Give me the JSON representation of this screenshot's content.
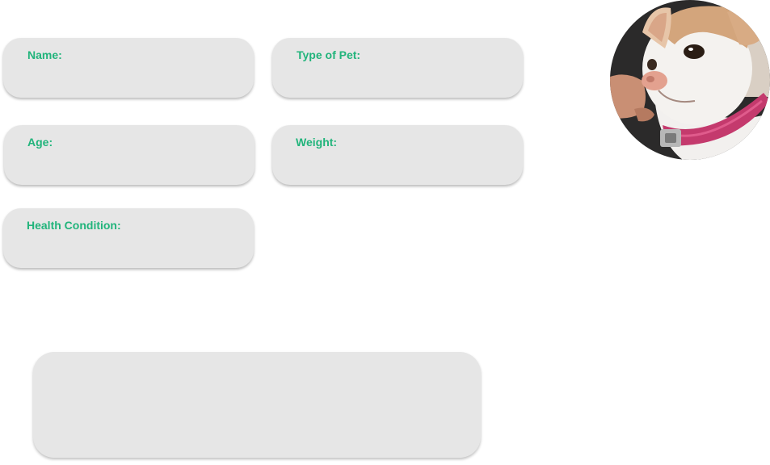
{
  "form": {
    "name_label": "Name:",
    "type_label": "Type of Pet:",
    "age_label": "Age:",
    "weight_label": "Weight:",
    "health_label": "Health Condition:",
    "name_value": "",
    "type_value": "",
    "age_value": "",
    "weight_value": "",
    "health_value": ""
  },
  "notes": {
    "value": ""
  },
  "colors": {
    "label": "#21b47b",
    "field_bg": "#e6e6e6"
  }
}
